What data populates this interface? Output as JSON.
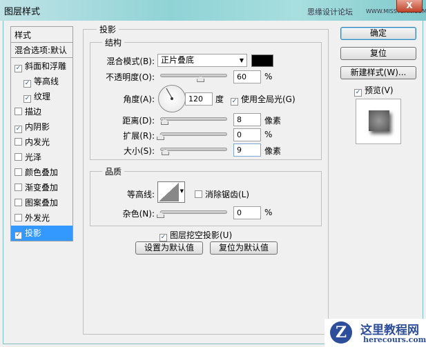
{
  "window": {
    "title": "图层样式",
    "watermark": "思缘设计论坛",
    "watermark_url": "WWW.MISSYUAN.COM",
    "close": "X"
  },
  "sidebar": {
    "items": [
      {
        "label": "样式",
        "type": "header"
      },
      {
        "label": "混合选项:默认",
        "type": "header"
      },
      {
        "label": "斜面和浮雕",
        "checked": true
      },
      {
        "label": "等高线",
        "checked": true,
        "indent": true
      },
      {
        "label": "纹理",
        "checked": true,
        "indent": true
      },
      {
        "label": "描边",
        "checked": false
      },
      {
        "label": "内阴影",
        "checked": true
      },
      {
        "label": "内发光",
        "checked": false
      },
      {
        "label": "光泽",
        "checked": false
      },
      {
        "label": "颜色叠加",
        "checked": false
      },
      {
        "label": "渐变叠加",
        "checked": false
      },
      {
        "label": "图案叠加",
        "checked": false
      },
      {
        "label": "外发光",
        "checked": false
      },
      {
        "label": "投影",
        "checked": true,
        "selected": true
      }
    ]
  },
  "panel": {
    "title": "投影",
    "structure": {
      "title": "结构",
      "blend_mode_label": "混合模式(B):",
      "blend_mode": "正片叠底",
      "color": "#000000",
      "opacity_label": "不透明度(O):",
      "opacity": "60",
      "opacity_unit": "%",
      "opacity_fraction": 0.6,
      "angle_label": "角度(A):",
      "angle": "120",
      "angle_unit": "度",
      "global_light_label": "使用全局光(G)",
      "global_light": true,
      "distance_label": "距离(D):",
      "distance": "8",
      "distance_unit": "像素",
      "spread_label": "扩展(R):",
      "spread": "0",
      "spread_unit": "%",
      "size_label": "大小(S):",
      "size": "9",
      "size_unit": "像素"
    },
    "quality": {
      "title": "品质",
      "contour_label": "等高线:",
      "antialias_label": "消除锯齿(L)",
      "antialias": false,
      "noise_label": "杂色(N):",
      "noise": "0",
      "noise_unit": "%"
    },
    "knockout_label": "图层挖空投影(U)",
    "knockout": true,
    "make_default": "设置为默认值",
    "reset_default": "复位为默认值"
  },
  "buttons": {
    "ok": "确定",
    "reset": "复位",
    "new_style": "新建样式(W)...",
    "preview_label": "预览(V)",
    "preview": true
  },
  "logo": {
    "text": "这里教程网",
    "url": "herecours.com"
  }
}
